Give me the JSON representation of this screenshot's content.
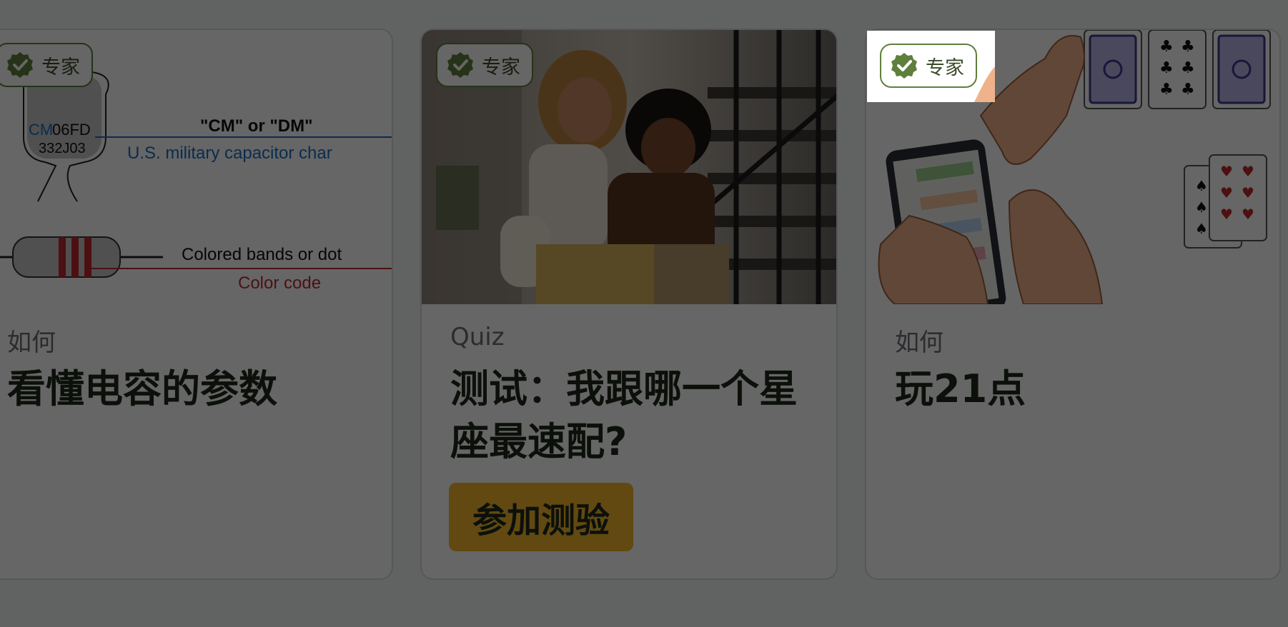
{
  "cards": [
    {
      "badge": "专家",
      "category": "如何",
      "title": "看懂电容的参数",
      "thumb": {
        "cap_code_prefix": "CM",
        "cap_code_rest": "06FD",
        "cap_code_line2": "332J03",
        "cm_dm_label": "\"CM\" or \"DM\"",
        "military_label": "U.S. military capacitor char",
        "bands_label": "Colored bands or dot",
        "color_code_label": "Color code"
      }
    },
    {
      "badge": "专家",
      "category": "Quiz",
      "title": "测试：我跟哪一个星座最速配?",
      "button": "参加测验"
    },
    {
      "badge": "专家",
      "category": "如何",
      "title": "玩21点"
    }
  ],
  "colors": {
    "badge_border": "#5f7f3c",
    "button": "#f2b62b",
    "overlay": "rgba(0,0,0,0.6)"
  },
  "icons": [
    "check-badge-icon"
  ]
}
